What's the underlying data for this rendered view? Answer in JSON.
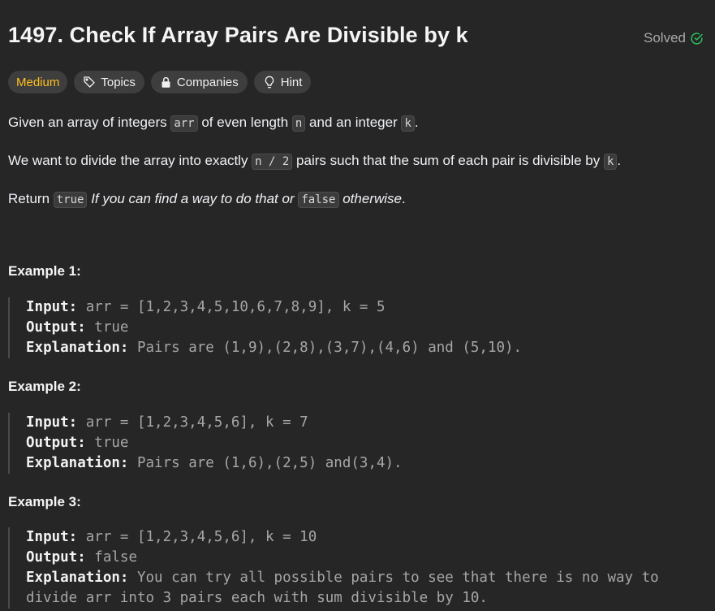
{
  "problem": {
    "title": "1497. Check If Array Pairs Are Divisible by k",
    "status": "Solved",
    "status_color": "#2cbb5d",
    "difficulty": "Medium",
    "difficulty_color": "#ffc01e"
  },
  "tags": {
    "topics": "Topics",
    "companies": "Companies",
    "hint": "Hint"
  },
  "description": {
    "p1": {
      "t1": "Given an array of integers ",
      "c1": "arr",
      "t2": " of even length ",
      "c2": "n",
      "t3": " and an integer ",
      "c3": "k",
      "t4": "."
    },
    "p2": {
      "t1": "We want to divide the array into exactly ",
      "c1": "n / 2",
      "t2": " pairs such that the sum of each pair is divisible by ",
      "c2": "k",
      "t3": "."
    },
    "p3": {
      "t1": "Return ",
      "c1": "true",
      "e1": " If you can find a way to do that or ",
      "c2": "false",
      "e2": " otherwise",
      "t2": "."
    }
  },
  "labels": {
    "input": "Input:",
    "output": "Output:",
    "explanation": "Explanation:"
  },
  "examples": [
    {
      "title": "Example 1:",
      "input": " arr = [1,2,3,4,5,10,6,7,8,9], k = 5",
      "output": " true",
      "explanation_lines": [
        " Pairs are (1,9),(2,8),(3,7),(4,6) and (5,10)."
      ]
    },
    {
      "title": "Example 2:",
      "input": " arr = [1,2,3,4,5,6], k = 7",
      "output": " true",
      "explanation_lines": [
        " Pairs are (1,6),(2,5) and(3,4)."
      ]
    },
    {
      "title": "Example 3:",
      "input": " arr = [1,2,3,4,5,6], k = 10",
      "output": " false",
      "explanation_lines": [
        " You can try all possible pairs to see that there is no way to",
        "divide arr into 3 pairs each with sum divisible by 10."
      ]
    }
  ]
}
